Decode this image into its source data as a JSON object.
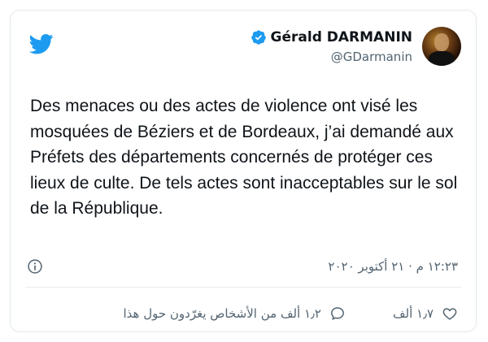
{
  "tweet": {
    "author": {
      "name": "Gérald DARMANIN",
      "handle": "@GDarmanin",
      "verified": true
    },
    "text": "Des menaces ou des actes de violence ont visé les mosquées de Béziers et de Bordeaux, j’ai demandé aux Préfets des départements concernés de protéger ces lieux de culte. De tels actes sont inacceptables sur le sol de la République.",
    "timestamp": "١٢:٢٣ م · ٢١ أكتوبر ٢٠٢٠",
    "likes": "١٫٧ ألف",
    "people_talking": "١٫٢ ألف من الأشخاص يغرّدون حول هذا"
  },
  "colors": {
    "brand_blue": "#1d9bf0",
    "text_primary": "#0f1419",
    "text_secondary": "#536471",
    "border": "#e1e8ed"
  },
  "icons": {
    "logo": "twitter-bird-icon",
    "verified": "verified-badge-icon",
    "info": "info-icon",
    "like": "heart-icon",
    "reply": "speech-bubble-icon"
  }
}
